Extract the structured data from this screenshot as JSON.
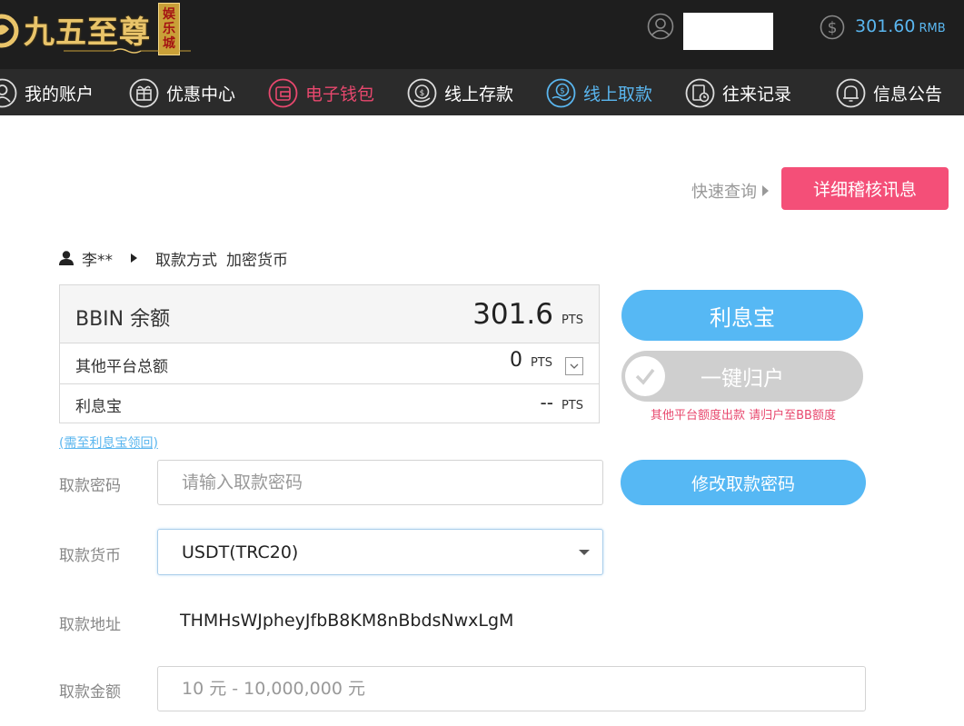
{
  "header": {
    "logo_text": "九五至尊",
    "logo_badge": [
      "娱",
      "乐",
      "城"
    ],
    "balance": "301.60",
    "balance_unit": "RMB",
    "icons": {
      "user": "user-icon",
      "coin": "dollar-coin-icon"
    }
  },
  "nav": {
    "items": [
      {
        "label": "我的账户",
        "icon": "account-icon"
      },
      {
        "label": "优惠中心",
        "icon": "gift-icon"
      },
      {
        "label": "电子钱包",
        "icon": "wallet-icon",
        "active": true
      },
      {
        "label": "线上存款",
        "icon": "deposit-icon"
      },
      {
        "label": "线上取款",
        "icon": "withdraw-icon",
        "selected": true
      },
      {
        "label": "往来记录",
        "icon": "records-icon"
      },
      {
        "label": "信息公告",
        "icon": "bell-icon"
      }
    ]
  },
  "quick": {
    "link": "快速查询",
    "detail_button": "详细稽核讯息"
  },
  "breadcrumb": {
    "user": "李**",
    "method_label": "取款方式",
    "method_value": "加密货币"
  },
  "balances": {
    "bbin_label": "BBIN 余额",
    "bbin_value": "301.6",
    "other_label": "其他平台总额",
    "other_value": "0",
    "lixibao_label": "利息宝",
    "lixibao_value": "--",
    "unit": "PTS",
    "recall_link": "(需至利息宝领回)"
  },
  "actions": {
    "lixibao_button": "利息宝",
    "onekey_button": "一键归户",
    "onekey_note": "其他平台额度出款 请归户至BB额度",
    "change_pw_button": "修改取款密码"
  },
  "form": {
    "password_label": "取款密码",
    "password_placeholder": "请输入取款密码",
    "currency_label": "取款货币",
    "currency_value": "USDT(TRC20)",
    "address_label": "取款地址",
    "address_value": "THMHsWJpheyJfbB8KM8nBbdsNwxLgM",
    "amount_label": "取款金额",
    "amount_placeholder": "10 元 - 10,000,000 元"
  },
  "colors": {
    "header_bg": "#1e1e1e",
    "nav_bg": "#2b2b2b",
    "accent_blue": "#56b8f4",
    "accent_pink": "#f44f78",
    "logo_gold": "#e9c46a"
  }
}
